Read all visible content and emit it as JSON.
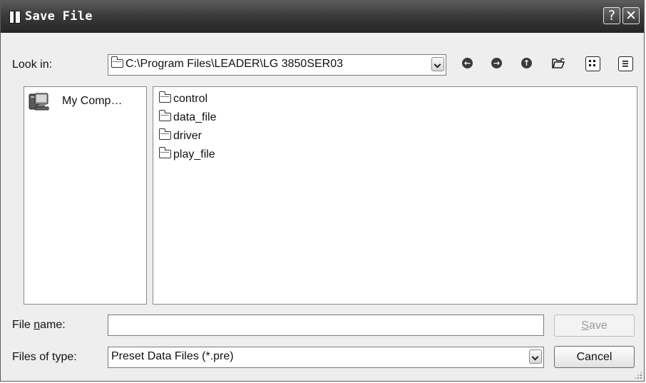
{
  "window": {
    "title": "Save File",
    "help_glyph": "?",
    "close_glyph": "✕"
  },
  "lookin": {
    "label": "Look in:",
    "path": "C:\\Program Files\\LEADER\\LG 3850SER03"
  },
  "nav_icons": [
    "back-icon",
    "forward-icon",
    "up-folder-icon",
    "new-folder-icon",
    "list-view-icon",
    "details-view-icon"
  ],
  "places": {
    "my_computer": "My Comp…"
  },
  "files": [
    "control",
    "data_file",
    "driver",
    "play_file"
  ],
  "filename": {
    "label_pre": "File ",
    "label_key": "n",
    "label_post": "ame:",
    "value": ""
  },
  "filetype": {
    "label": "Files of type:",
    "value": "Preset Data Files (*.pre)"
  },
  "buttons": {
    "save_key": "S",
    "save_rest": "ave",
    "cancel": "Cancel"
  }
}
